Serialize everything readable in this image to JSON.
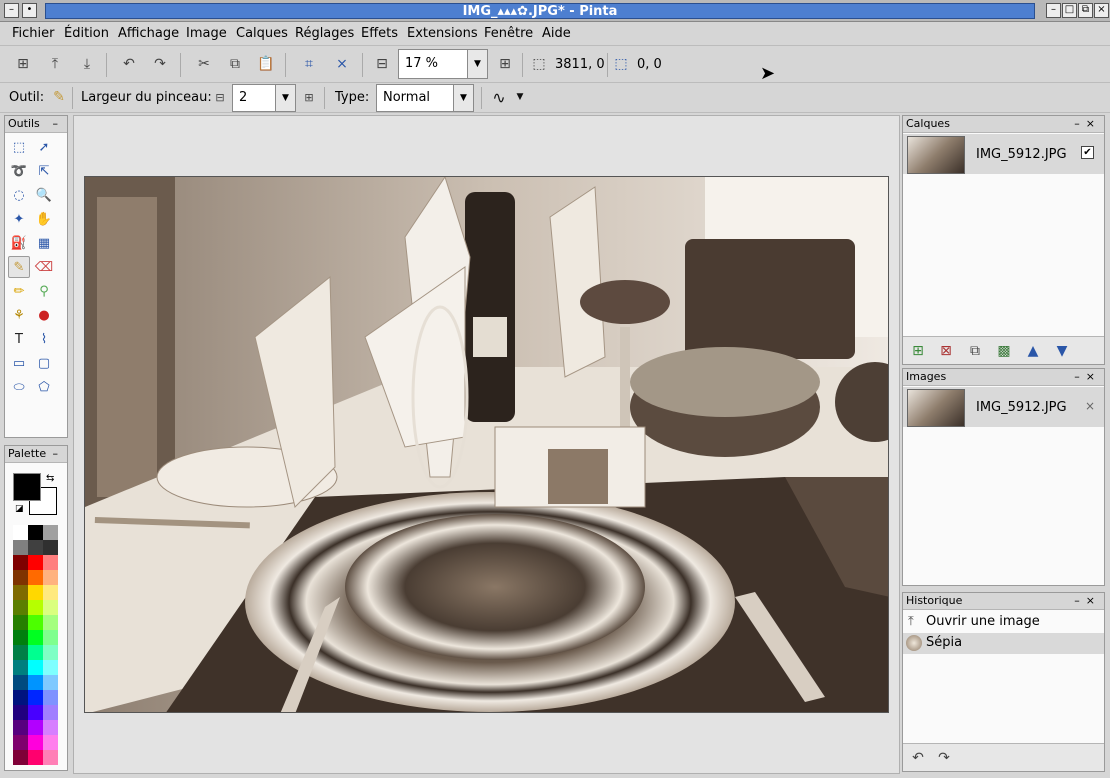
{
  "window": {
    "title": "IMG_▴▴▴✿.JPG* - Pinta",
    "controls": [
      "–",
      "□",
      "×"
    ]
  },
  "menu": [
    "Fichier",
    "Édition",
    "Affichage",
    "Image",
    "Calques",
    "Réglages",
    "Effets",
    "Extensions",
    "Fenêtre",
    "Aide"
  ],
  "toolbar": {
    "zoom_value": "17 %",
    "image_size": "3811, 0",
    "selection_size": "0, 0"
  },
  "toolbar2": {
    "tool_label": "Outil:",
    "brush_width_label": "Largeur du pinceau:",
    "brush_width_value": "2",
    "type_label": "Type:",
    "type_value": "Normal"
  },
  "panels": {
    "tools_title": "Outils",
    "palette_title": "Palette",
    "layers_title": "Calques",
    "images_title": "Images",
    "history_title": "Historique"
  },
  "layers": [
    {
      "name": "IMG_5912.JPG",
      "visible": true
    }
  ],
  "images": [
    {
      "name": "IMG_5912.JPG"
    }
  ],
  "history": [
    {
      "label": "Ouvrir une image",
      "icon": "open-image-icon"
    },
    {
      "label": "Sépia",
      "icon": "sepia-icon"
    }
  ],
  "colors": {
    "primary": "#000000",
    "secondary": "#ffffff",
    "palette": [
      "#ffffff",
      "#000000",
      "#a0a0a0",
      "#808080",
      "#404040",
      "#303030",
      "#7f0000",
      "#ff0000",
      "#ff7f7f",
      "#7f3300",
      "#ff6a00",
      "#ffb27f",
      "#7f6a00",
      "#ffd800",
      "#ffe97f",
      "#5b7f00",
      "#b6ff00",
      "#daff7f",
      "#267f00",
      "#4cff00",
      "#a5ff7f",
      "#007f0e",
      "#00ff21",
      "#7fff8e",
      "#007f46",
      "#00ff90",
      "#7fffc5",
      "#007f7f",
      "#00ffff",
      "#7fffff",
      "#004a7f",
      "#0094ff",
      "#7fc9ff",
      "#00137f",
      "#0026ff",
      "#7f92ff",
      "#21007f",
      "#4800ff",
      "#a17fff",
      "#57007f",
      "#b200ff",
      "#d67fff",
      "#7f006e",
      "#ff00dc",
      "#ff7fed",
      "#7f0037",
      "#ff006e",
      "#ff7fb6"
    ]
  }
}
